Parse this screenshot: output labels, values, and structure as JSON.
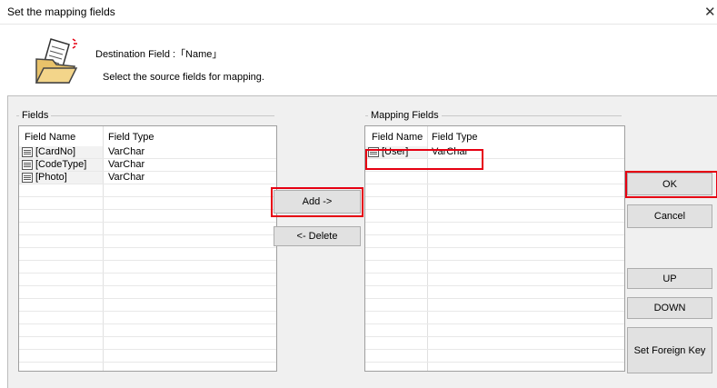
{
  "window": {
    "title": "Set the mapping fields",
    "close_glyph": "✕"
  },
  "header": {
    "destination_label": "Destination Field :「Name」",
    "instruction": "Select the source fields for mapping."
  },
  "fields": {
    "group_label": "Fields",
    "columns": [
      "Field Name",
      "Field Type"
    ],
    "rows": [
      {
        "name": "[CardNo]",
        "type": "VarChar"
      },
      {
        "name": "[CodeType]",
        "type": "VarChar"
      },
      {
        "name": "[Photo]",
        "type": "VarChar"
      }
    ]
  },
  "mapping": {
    "group_label": "Mapping Fields",
    "columns": [
      "Field Name",
      "Field Type"
    ],
    "rows": [
      {
        "name": "[User]",
        "type": "VarChar"
      }
    ]
  },
  "buttons": {
    "add": "Add ->",
    "delete": "<- Delete",
    "ok": "OK",
    "cancel": "Cancel",
    "up": "UP",
    "down": "DOWN",
    "foreign_key": "Set Foreign Key"
  },
  "colors": {
    "highlight": "#e60012",
    "dialog_bg": "#f0f0f0",
    "button_bg": "#e1e1e1"
  },
  "icons": {
    "header": "folder-document-icon",
    "row": "table-icon"
  }
}
